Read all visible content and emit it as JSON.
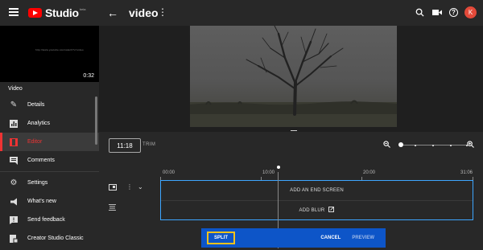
{
  "app": {
    "name": "Studio",
    "beta": "beta"
  },
  "header": {
    "title": "video",
    "avatar_letter": "K"
  },
  "icons": {
    "menu": "menu-icon",
    "back": "arrow-left-icon",
    "more": "more-vert-icon",
    "search": "search-icon",
    "create": "video-camera-icon",
    "help": "help-icon"
  },
  "sidebar": {
    "thumbnail_caption": "http://www.youtube.com/watch?v=video",
    "duration": "0:32",
    "section_label": "Video",
    "items": [
      {
        "label": "Details",
        "icon": "pencil-icon"
      },
      {
        "label": "Analytics",
        "icon": "bar-chart-icon"
      },
      {
        "label": "Editor",
        "icon": "film-icon",
        "active": true
      },
      {
        "label": "Comments",
        "icon": "comment-icon"
      },
      {
        "label": "Settings",
        "icon": "gear-icon"
      },
      {
        "label": "What's new",
        "icon": "megaphone-icon"
      },
      {
        "label": "Send feedback",
        "icon": "feedback-icon"
      },
      {
        "label": "Creator Studio Classic",
        "icon": "classic-icon"
      }
    ]
  },
  "editor": {
    "time_value": "11:18",
    "trim_label": "TRIM",
    "zoom_level": 0.0,
    "ruler_labels": [
      "00:00",
      "10:00",
      "20:00",
      "31:06"
    ],
    "tracks": {
      "end_screen": "ADD AN END SCREEN",
      "blur": "ADD BLUR"
    },
    "actions": {
      "split": "SPLIT",
      "cancel": "CANCEL",
      "preview": "PREVIEW"
    }
  },
  "colors": {
    "accent_blue": "#3ea6ff",
    "action_bar": "#0d55c8",
    "highlight": "#f4c21b",
    "active_red": "#e33333"
  }
}
